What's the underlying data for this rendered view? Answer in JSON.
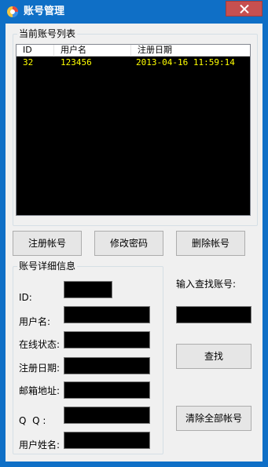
{
  "window": {
    "title": "账号管理"
  },
  "list_group": {
    "title": "当前账号列表",
    "columns": [
      "ID",
      "用户名",
      "注册日期"
    ],
    "rows": [
      [
        "32",
        "123456",
        "2013-04-16 11:59:14"
      ]
    ]
  },
  "actions": {
    "register": "注册帐号",
    "change_password": "修改密码",
    "delete": "删除帐号"
  },
  "details": {
    "title": "账号详细信息",
    "id_label": "ID:",
    "username_label": "用户名:",
    "online_label": "在线状态:",
    "regdate_label": "注册日期:",
    "email_label": "邮箱地址:",
    "qq_label": "Q  Q :",
    "realname_label": "用户姓名:"
  },
  "search": {
    "label": "输入查找账号:",
    "button": "查找",
    "clear_button": "清除全部帐号"
  },
  "colors": {
    "titlebar": "#0f6fc6",
    "list_text": "#ffff00",
    "close": "#c75050"
  },
  "icons": {
    "app": "app-icon",
    "close": "close-icon"
  }
}
